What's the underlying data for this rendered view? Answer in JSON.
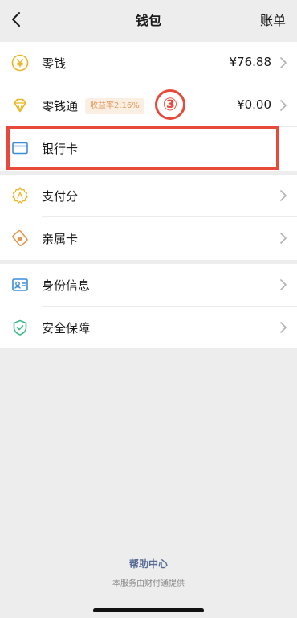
{
  "header": {
    "title": "钱包",
    "right_action": "账单",
    "back_icon": "chevron-left-icon"
  },
  "groups": [
    {
      "items": [
        {
          "label": "零钱",
          "value": "¥76.88",
          "icon": "yuan-coin-icon"
        },
        {
          "label": "零钱通",
          "badge": "收益率2.16%",
          "value": "¥0.00",
          "icon": "diamond-icon"
        },
        {
          "label": "银行卡",
          "icon": "bank-card-icon"
        }
      ]
    },
    {
      "items": [
        {
          "label": "支付分",
          "icon": "pay-score-icon"
        },
        {
          "label": "亲属卡",
          "icon": "family-card-icon"
        }
      ]
    },
    {
      "items": [
        {
          "label": "身份信息",
          "icon": "id-card-icon"
        },
        {
          "label": "安全保障",
          "icon": "shield-check-icon"
        }
      ]
    }
  ],
  "annotation": {
    "step_marker": "③",
    "color": "#e7493b"
  },
  "footer": {
    "help_link": "帮助中心",
    "provider_note": "本服务由财付通提供"
  },
  "colors": {
    "background": "#ededed",
    "card": "#ffffff",
    "link": "#576b95",
    "badge_bg": "#fbeee2",
    "badge_text": "#e19b5d",
    "gold": "#e8b628",
    "blue": "#3b8cd8",
    "orange": "#e8934a",
    "green": "#3fb88a"
  }
}
